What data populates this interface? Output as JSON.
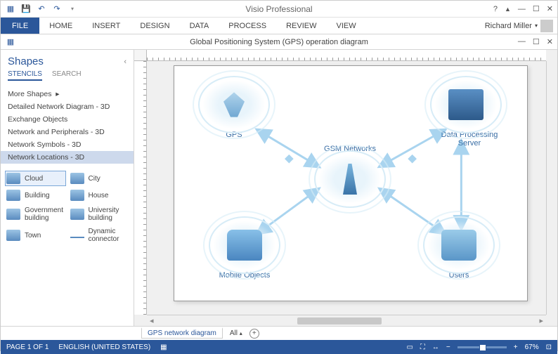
{
  "app_title": "Visio Professional",
  "user_name": "Richard Miller",
  "qat": {
    "save": "Save",
    "undo": "Undo",
    "redo": "Redo"
  },
  "ribbon_tabs": [
    "FILE",
    "HOME",
    "INSERT",
    "DESIGN",
    "DATA",
    "PROCESS",
    "REVIEW",
    "VIEW"
  ],
  "document_title": "Global Positioning System (GPS) operation diagram",
  "shapes_panel": {
    "title": "Shapes",
    "tabs": {
      "stencils": "STENCILS",
      "search": "SEARCH"
    },
    "more_shapes": "More Shapes",
    "stencils": [
      "Detailed Network Diagram - 3D",
      "Exchange Objects",
      "Network and Peripherals - 3D",
      "Network Symbols - 3D",
      "Network Locations - 3D"
    ],
    "selected_index": 4,
    "shapes": [
      {
        "label": "Cloud",
        "selected": true
      },
      {
        "label": "City"
      },
      {
        "label": "Building"
      },
      {
        "label": "House"
      },
      {
        "label": "Government building"
      },
      {
        "label": "University building"
      },
      {
        "label": "Town"
      },
      {
        "label": "Dynamic connector"
      }
    ]
  },
  "diagram": {
    "nodes": {
      "gps": "GPS",
      "gsm": "GSM Networks",
      "server": "Data Processing Server",
      "mobile": "Mobile Objects",
      "users": "Users"
    }
  },
  "sheet_tab": "GPS network diagram",
  "sheet_all": "All",
  "status": {
    "page": "PAGE 1 OF 1",
    "lang": "ENGLISH (UNITED STATES)",
    "zoom": "67%"
  }
}
